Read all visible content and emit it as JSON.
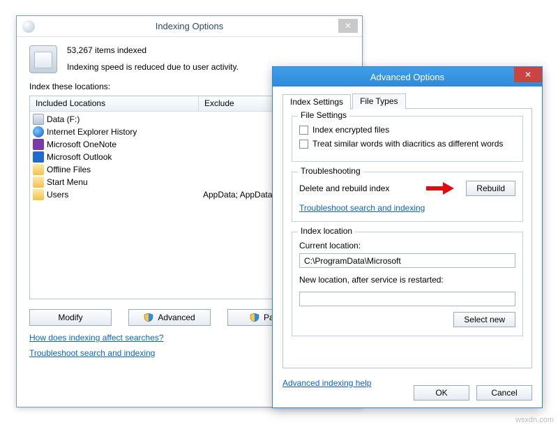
{
  "indexing": {
    "title": "Indexing Options",
    "items_indexed": "53,267 items indexed",
    "speed_note": "Indexing speed is reduced due to user activity.",
    "locations_label": "Index these locations:",
    "col_included": "Included Locations",
    "col_exclude": "Exclude",
    "rows": [
      {
        "label": "Data (F:)",
        "exclude": ""
      },
      {
        "label": "Internet Explorer History",
        "exclude": ""
      },
      {
        "label": "Microsoft OneNote",
        "exclude": ""
      },
      {
        "label": "Microsoft Outlook",
        "exclude": ""
      },
      {
        "label": "Offline Files",
        "exclude": ""
      },
      {
        "label": "Start Menu",
        "exclude": ""
      },
      {
        "label": "Users",
        "exclude": "AppData; AppData"
      }
    ],
    "btn_modify": "Modify",
    "btn_advanced": "Advanced",
    "btn_pause": "Pause",
    "link_affect": "How does indexing affect searches?",
    "link_troubleshoot": "Troubleshoot search and indexing"
  },
  "advanced": {
    "title": "Advanced Options",
    "tab_index_settings": "Index Settings",
    "tab_file_types": "File Types",
    "grp_file_settings": "File Settings",
    "cb_encrypted": "Index encrypted files",
    "cb_diacritics": "Treat similar words with diacritics as different words",
    "grp_troubleshoot": "Troubleshooting",
    "lbl_rebuild": "Delete and rebuild index",
    "btn_rebuild": "Rebuild",
    "link_troubleshoot": "Troubleshoot search and indexing",
    "grp_location": "Index location",
    "lbl_current": "Current location:",
    "val_current": "C:\\ProgramData\\Microsoft",
    "lbl_newloc": "New location, after service is restarted:",
    "btn_selectnew": "Select new",
    "link_help": "Advanced indexing help",
    "btn_ok": "OK",
    "btn_cancel": "Cancel"
  },
  "watermark": "wsxdn.com"
}
